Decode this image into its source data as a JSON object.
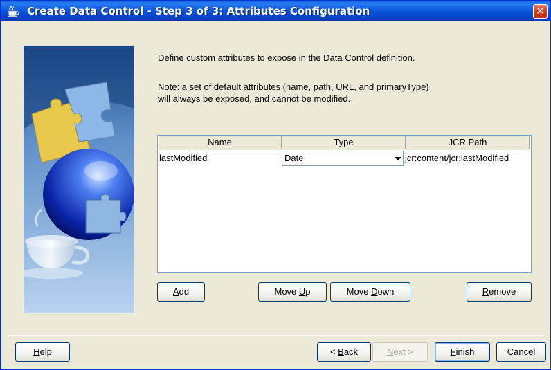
{
  "window": {
    "title": "Create Data Control - Step 3 of 3: Attributes Configuration",
    "close_label": "✕"
  },
  "content": {
    "description": "Define custom attributes to expose in the Data Control definition.",
    "note_line1": "Note: a set of default attributes (name, path, URL, and primaryType)",
    "note_line2": "will always be exposed, and cannot be modified."
  },
  "table": {
    "columns": [
      "Name",
      "Type",
      "JCR Path"
    ],
    "rows": [
      {
        "name": "lastModified",
        "type": "Date",
        "jcr_path": "jcr:content/jcr:lastModified"
      }
    ]
  },
  "buttons": {
    "add": {
      "pre": "",
      "mn": "A",
      "post": "dd"
    },
    "move_up": {
      "pre": "Move ",
      "mn": "U",
      "post": "p"
    },
    "move_down": {
      "pre": "Move ",
      "mn": "D",
      "post": "own"
    },
    "remove": {
      "pre": "",
      "mn": "R",
      "post": "emove"
    },
    "help": {
      "pre": "",
      "mn": "H",
      "post": "elp"
    },
    "back": {
      "pre": "< ",
      "mn": "B",
      "post": "ack"
    },
    "next": {
      "pre": "",
      "mn": "N",
      "post": "ext >"
    },
    "finish": {
      "pre": "",
      "mn": "F",
      "post": "inish"
    },
    "cancel": {
      "pre": "",
      "mn": "",
      "post": "Cancel"
    }
  },
  "icons": {
    "title_icon": "coffee-cup-icon",
    "close": "close-icon",
    "dropdown": "chevron-down-icon"
  },
  "colors": {
    "titlebar": "#0855dd",
    "dialog_bg": "#ece9d8",
    "close_button": "#d9391b",
    "button_border": "#003c74"
  }
}
